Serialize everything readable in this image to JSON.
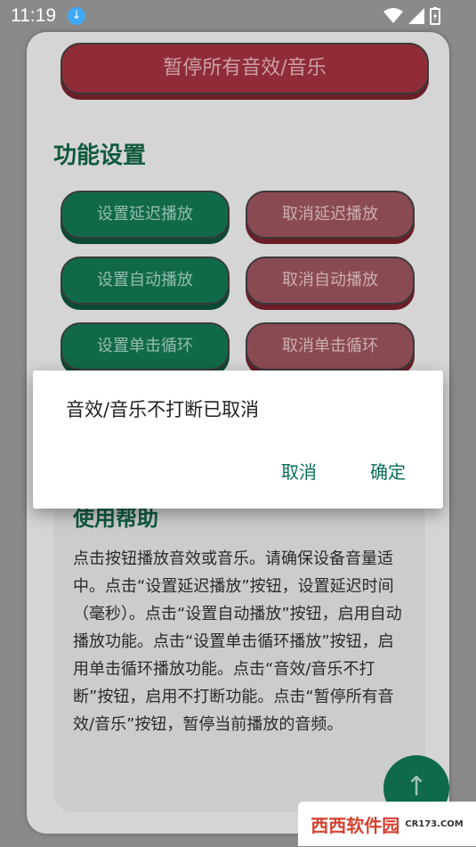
{
  "statusbar": {
    "time": "11:19"
  },
  "main": {
    "pause_all_label": "暂停所有音效/音乐",
    "section_title": "功能设置",
    "buttons": [
      {
        "label": "设置延迟播放"
      },
      {
        "label": "取消延迟播放"
      },
      {
        "label": "设置自动播放"
      },
      {
        "label": "取消自动播放"
      },
      {
        "label": "设置单击循环"
      },
      {
        "label": "取消单击循环"
      }
    ],
    "help_title": "使用帮助",
    "help_text": "点击按钮播放音效或音乐。请确保设备音量适中。点击“设置延迟播放”按钮，设置延迟时间（毫秒）。点击“设置自动播放”按钮，启用自动播放功能。点击“设置单击循环播放”按钮，启用单击循环播放功能。点击“音效/音乐不打断”按钮，启用不打断功能。点击“暂停所有音效/音乐”按钮，暂停当前播放的音频。",
    "fab_icon": "arrow-up-icon"
  },
  "dialog": {
    "message": "音效/音乐不打断已取消",
    "cancel_label": "取消",
    "confirm_label": "确定"
  },
  "watermark": {
    "brand": "西西软件园",
    "sub": "CR173.COM"
  },
  "colors": {
    "green": "#106a48",
    "red": "#8f2c38",
    "accent": "#0b6f5b"
  }
}
